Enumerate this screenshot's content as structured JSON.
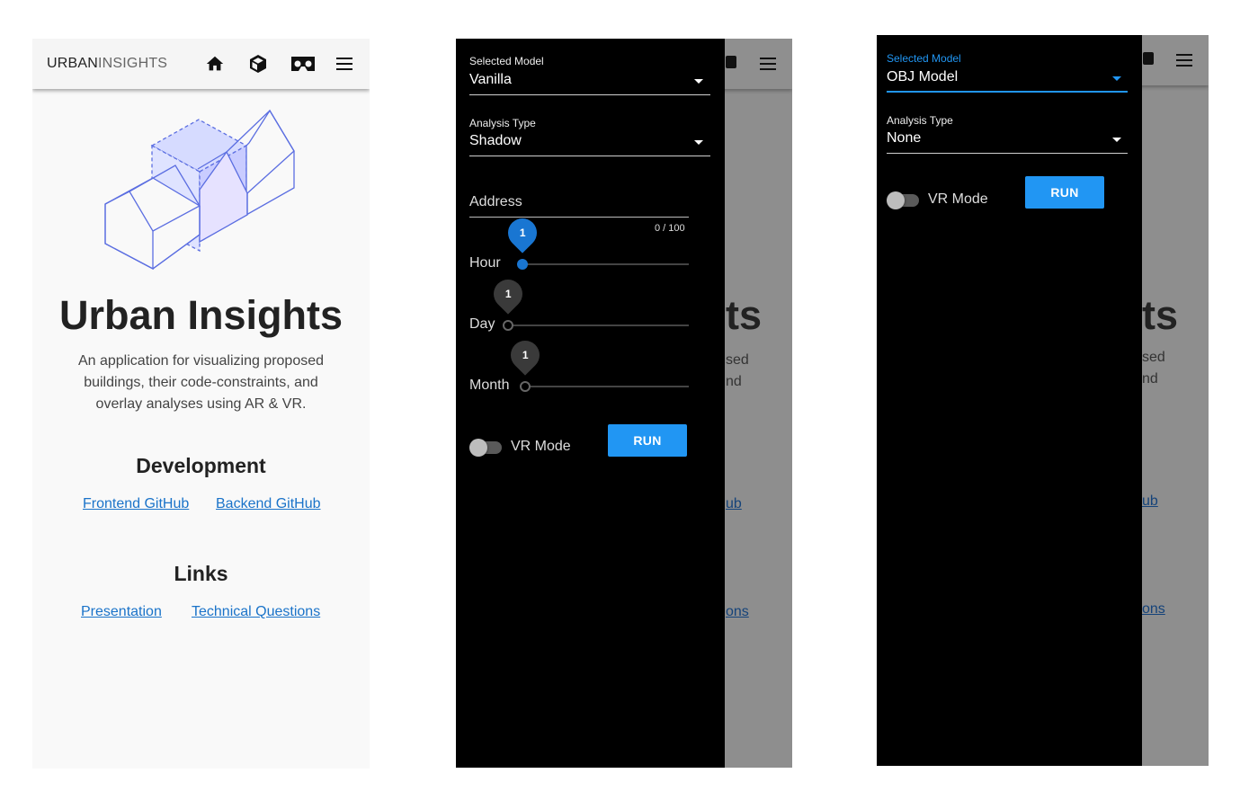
{
  "home": {
    "brand_bold": "URBAN",
    "brand_light": "INSIGHTS",
    "title": "Urban Insights",
    "description_lines": [
      "An application for visualizing proposed",
      "buildings, their code-constraints, and",
      "overlay analyses using AR & VR."
    ],
    "development_heading": "Development",
    "frontend_link": "Frontend GitHub",
    "backend_link": "Backend GitHub",
    "links_heading": "Links",
    "presentation_link": "Presentation",
    "technical_link": "Technical Questions",
    "nav_icons": [
      "home-icon",
      "cube-icon",
      "vr-headset-icon",
      "menu-icon"
    ]
  },
  "drawer1": {
    "model_label": "Selected Model",
    "model_value": "Vanilla",
    "analysis_label": "Analysis Type",
    "analysis_value": "Shadow",
    "address_placeholder": "Address",
    "address_counter": "0 / 100",
    "hour_label": "Hour",
    "hour_value": "1",
    "day_label": "Day",
    "day_value": "1",
    "month_label": "Month",
    "month_value": "1",
    "vr_label": "VR Mode",
    "run_label": "RUN"
  },
  "drawer2": {
    "model_label": "Selected Model",
    "model_value": "OBJ Model",
    "analysis_label": "Analysis Type",
    "analysis_value": "None",
    "vr_label": "VR Mode",
    "run_label": "RUN"
  },
  "dimmed_background": {
    "title_fragment": "ts",
    "line1_fragment": "sed",
    "line2_fragment": "nd",
    "link1_fragment": "ub",
    "link2_fragment": "ons"
  },
  "colors": {
    "accent": "#2196f3",
    "slider_active": "#1976d2",
    "link": "#1a73c9",
    "illustration": "#5b6ee1"
  }
}
